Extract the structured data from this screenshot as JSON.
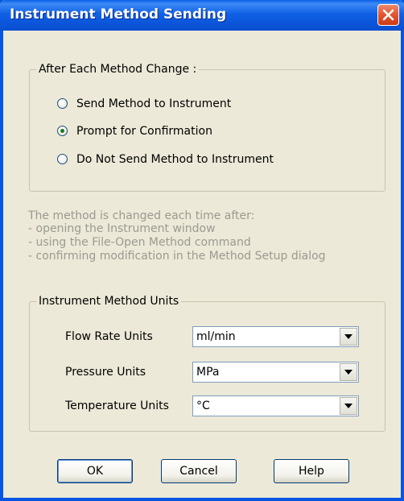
{
  "window": {
    "title": "Instrument Method Sending"
  },
  "after_change": {
    "legend": "After Each Method Change :",
    "options": [
      {
        "label": "Send Method to Instrument",
        "checked": false
      },
      {
        "label": "Prompt for Confirmation",
        "checked": true
      },
      {
        "label": "Do Not Send Method to Instrument",
        "checked": false
      }
    ]
  },
  "info_lines": [
    "The method is changed each time after:",
    "- opening the Instrument window",
    "- using the File-Open Method command",
    "- confirming modification in the Method Setup dialog"
  ],
  "units": {
    "legend": "Instrument Method Units",
    "flow_rate": {
      "label": "Flow Rate Units",
      "value": "ml/min"
    },
    "pressure": {
      "label": "Pressure Units",
      "value": "MPa"
    },
    "temperature": {
      "label": "Temperature Units",
      "value": "°C"
    }
  },
  "buttons": {
    "ok": "OK",
    "cancel": "Cancel",
    "help": "Help"
  },
  "colors": {
    "title_bar": "#0a5fe8",
    "dialog_bg": "#ece9d8",
    "close_button": "#e2532f"
  },
  "icons": {
    "close": "close-icon",
    "dropdown": "chevron-down-icon"
  }
}
